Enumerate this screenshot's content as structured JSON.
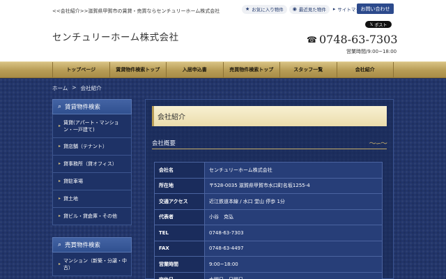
{
  "header": {
    "tagline": "<<会社紹介>>滋賀県甲賀市の賃貸・売買ならセンチュリーホーム株式会社",
    "site_title": "センチュリーホーム株式会社",
    "links": [
      {
        "label": "お気に入り物件",
        "icon": "star-icon"
      },
      {
        "label": "最近見た物件",
        "icon": "eye-icon"
      },
      {
        "label": "サイトマップ",
        "icon": "sitemap-icon"
      }
    ],
    "inquiry_label": "お問い合わせ",
    "x_post_label": "ポスト",
    "phone": "0748-63-7303",
    "hours": "営業時間/9:00~18:00"
  },
  "nav": {
    "items": [
      "トップページ",
      "賃貸物件検索トップ",
      "入居申込書",
      "売買物件検索トップ",
      "スタッフ一覧",
      "会社紹介"
    ]
  },
  "breadcrumb": {
    "home": "ホーム",
    "sep": ">",
    "current": "会社紹介"
  },
  "sidebar": {
    "rent_title": "賃貸物件検索",
    "rent_items": [
      "賃貸(アパート・マンション・一戸建て)",
      "貸店舗（テナント）",
      "貸事務所（貸オフィス）",
      "貸駐車場",
      "貸土地",
      "貸ビル・貸倉庫・その他"
    ],
    "sale_title": "売買物件検索",
    "sale_items": [
      "マンション（新築・分譲・中古）"
    ]
  },
  "main": {
    "page_title": "会社紹介",
    "section_title": "会社概要",
    "rows": [
      {
        "key": "会社名",
        "value": "センチュリーホーム株式会社"
      },
      {
        "key": "所在地",
        "value": "〒528-0035 滋賀県甲賀市水口町名坂1255-4"
      },
      {
        "key": "交通アクセス",
        "value": "近江鉄道本線 / 水口 堂山 停歩 1分"
      },
      {
        "key": "代表者",
        "value": "小谷　克弘"
      },
      {
        "key": "TEL",
        "value": "0748-63-7303"
      },
      {
        "key": "FAX",
        "value": "0748-63-4497"
      },
      {
        "key": "営業時間",
        "value": "9:00~18:00"
      },
      {
        "key": "定休日",
        "value": "水曜日・日曜日"
      }
    ]
  },
  "colors": {
    "navy": "#1f2f5c",
    "gold": "#b79c55",
    "button_blue": "#2c4a8c"
  }
}
